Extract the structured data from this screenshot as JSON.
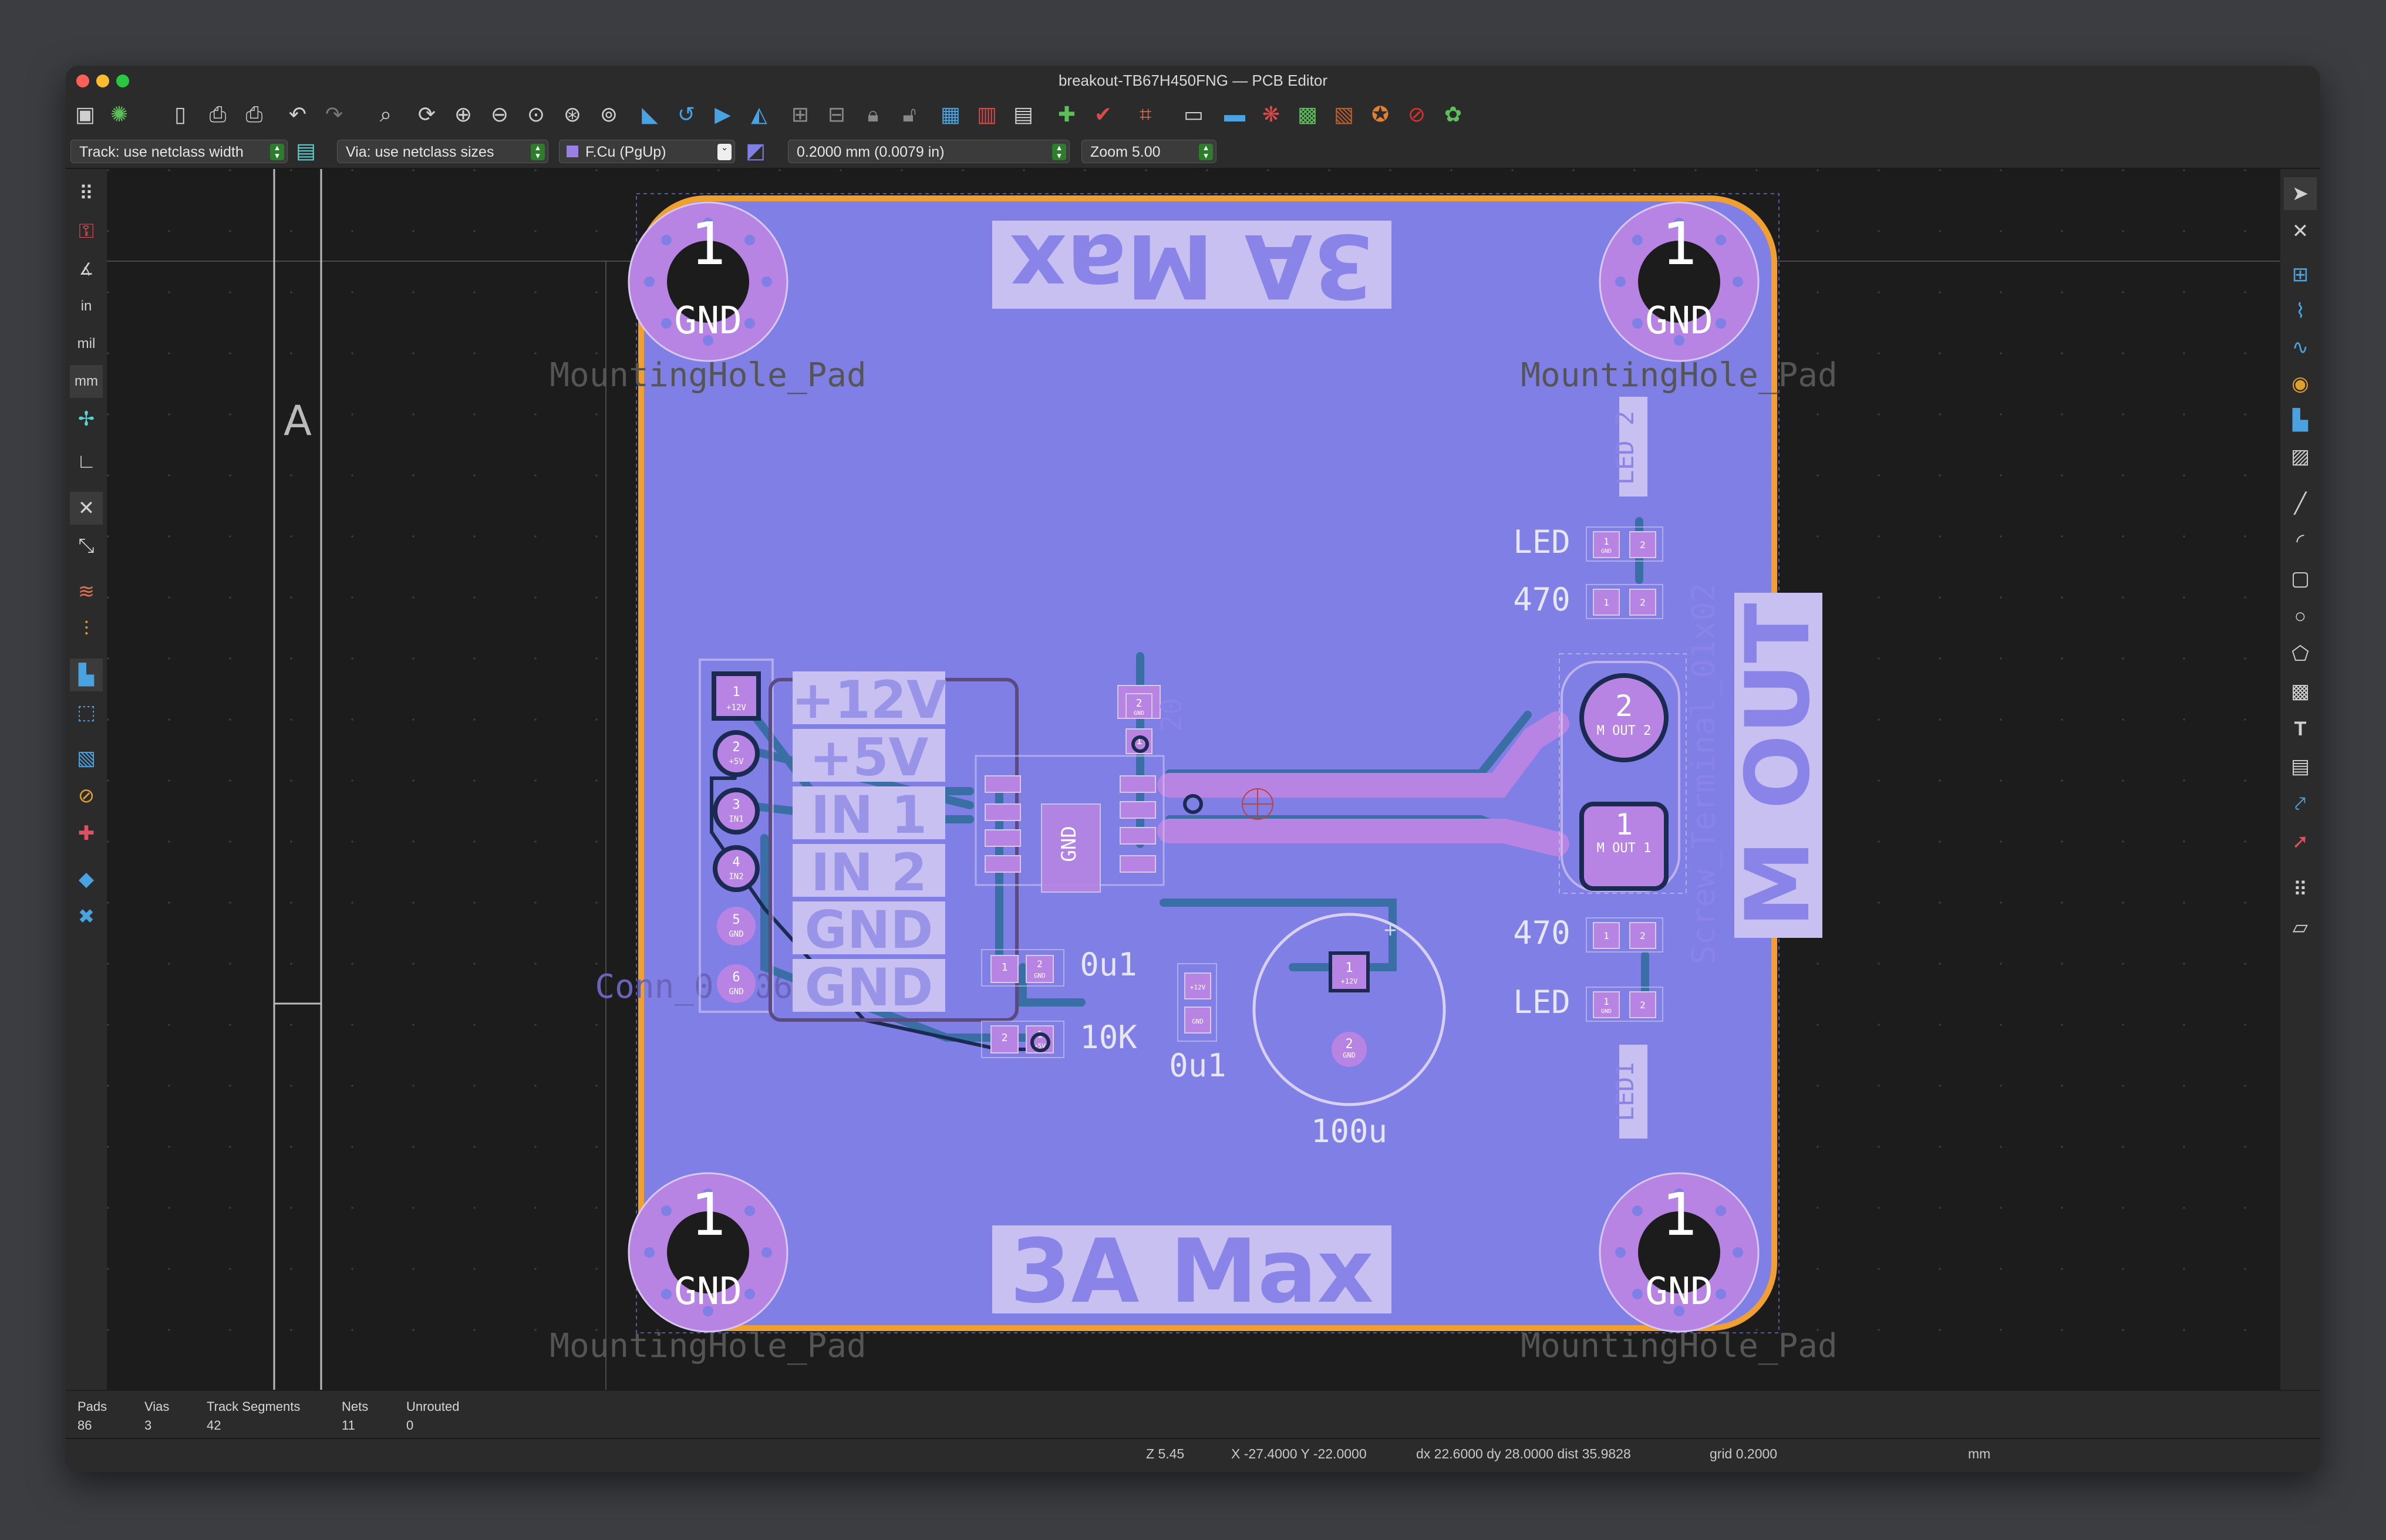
{
  "window": {
    "title": "breakout-TB67H450FNG — PCB Editor"
  },
  "icons": {
    "top": [
      "save-icon",
      "footprint-editor-icon",
      "page-settings-icon",
      "print-icon",
      "plot-icon",
      "undo-icon",
      "redo-icon",
      "find-icon",
      "refresh-icon",
      "zoom-in-icon",
      "zoom-out-icon",
      "zoom-fit-icon",
      "zoom-objects-icon",
      "zoom-selection-icon",
      "flip-board-icon",
      "rotate-ccw-icon",
      "rotate-cw-icon",
      "mirror-icon",
      "group-icon",
      "ungroup-icon",
      "lock-icon",
      "unlock-icon",
      "netlist-icon",
      "footprint-browser-icon",
      "update-pcb-icon",
      "drc-icon",
      "schematic-icon",
      "scripting-console-icon",
      "show-ratsnest-icon",
      "fabrication-outputs-icon",
      "3d-viewer-icon",
      "router-icon",
      "gerber-icon",
      "cancel-icon",
      "python-plugin-icon"
    ],
    "left": [
      "grid-icon",
      "ratsnest-lock-icon",
      "polar-coords-icon",
      "inch-units-icon",
      "mil-units-icon",
      "mm-units-icon",
      "cursor-crosshair-icon",
      "local-origin-icon",
      "ratsnest-icon",
      "curved-ratsnest-icon",
      "high-contrast-icon",
      "track-outline-icon",
      "pad-outline-icon",
      "via-outline-icon",
      "zone-fill-icon",
      "net-inspector-icon",
      "layers-manager-icon",
      "properties-icon"
    ],
    "right": [
      "select-icon",
      "local-ratsnest-icon",
      "place-footprint-icon",
      "route-track-icon",
      "tune-length-icon",
      "add-via-icon",
      "add-zone-icon",
      "rule-area-icon",
      "draw-line-icon",
      "draw-arc-icon",
      "draw-rect-icon",
      "draw-circle-icon",
      "draw-polygon-icon",
      "add-image-icon",
      "add-text-icon",
      "add-textbox-icon",
      "dimension-icon",
      "delete-icon",
      "set-origin-icon",
      "measure-icon"
    ]
  },
  "toolbar2": {
    "track": "Track: use netclass width",
    "via": "Via: use netclass sizes",
    "layer": "F.Cu (PgUp)",
    "grid": "0.2000 mm (0.0079 in)",
    "zoom": "Zoom 5.00"
  },
  "board": {
    "ruler_letter": "A",
    "mounting_hole": {
      "pad": "1",
      "net": "GND",
      "label": "MountingHole_Pad"
    },
    "silk_top": "3A Max",
    "silk_bottom": "3A Max",
    "connector": {
      "labels": [
        "+12V",
        "+5V",
        "IN 1",
        "IN 2",
        "GND",
        "GND"
      ],
      "pins": [
        "1",
        "2",
        "3",
        "4",
        "5",
        "6"
      ],
      "pin_nets": [
        "+12V",
        "+5V",
        "IN1",
        "IN2",
        "GND",
        "GND"
      ],
      "ref": "Conn_01x06"
    },
    "ic": {
      "label": "GND"
    },
    "cap_top": {
      "pads": [
        "2",
        "1"
      ],
      "nets": [
        "GND",
        ""
      ],
      "value": "20"
    },
    "caps": {
      "c1": "0u1",
      "c2": "0u1",
      "r1": "10K",
      "c_big": "100u",
      "c_big_pads": [
        "1",
        "2"
      ],
      "c_big_nets": [
        "+12V",
        "GND"
      ],
      "c1_nets": [
        "1",
        "2",
        "GND"
      ],
      "r1_nets": [
        "2",
        "1",
        "+5V"
      ],
      "c2_nets": [
        "+12V",
        "GND"
      ]
    },
    "leds": {
      "led2_ref": "LED 2",
      "led1_ref": "LED1",
      "led": "LED",
      "r": "470",
      "pad1": "1",
      "pad2": "2",
      "gnd": "GND"
    },
    "terminal": {
      "pads": [
        "2",
        "1"
      ],
      "nets": [
        "M OUT 2",
        "M OUT 1"
      ],
      "ref": "Screw_Terminal_01x02",
      "silk": "M OUT"
    }
  },
  "status": {
    "headers": [
      "Pads",
      "Vias",
      "Track Segments",
      "Nets",
      "Unrouted"
    ],
    "values": [
      "86",
      "3",
      "42",
      "11",
      "0"
    ],
    "zoom": "Z 5.45",
    "xy": "X -27.4000  Y -22.0000",
    "delta": "dx 22.6000  dy 28.0000  dist 35.9828",
    "grid": "grid 0.2000",
    "units": "mm"
  },
  "colors": {
    "board": "#7f7fe6",
    "copper": "#b784e3",
    "edge": "#f0a030",
    "track": "#3a6fa5",
    "silk": "#e6e6f6"
  }
}
